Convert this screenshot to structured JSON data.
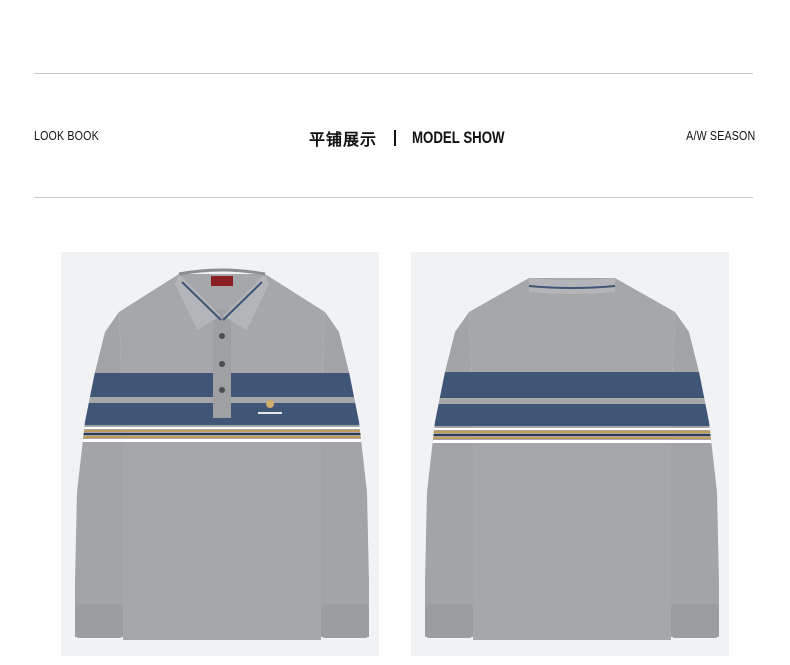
{
  "header": {
    "left_label": "LOOK BOOK",
    "center_cn": "平铺展示",
    "center_en": "MODEL SHOW",
    "right_label": "A/W SEASON"
  },
  "colors": {
    "shirt_gray": "#a4a5a8",
    "shirt_gray_dark": "#8e8f93",
    "navy_stripe": "#3f5677",
    "tan_stripe": "#c29a5a",
    "white_stripe": "#f3f3f3",
    "background": "#f1f2f4"
  },
  "photos": [
    {
      "view": "front",
      "icon": "polo-shirt-front-icon"
    },
    {
      "view": "back",
      "icon": "polo-shirt-back-icon"
    }
  ]
}
